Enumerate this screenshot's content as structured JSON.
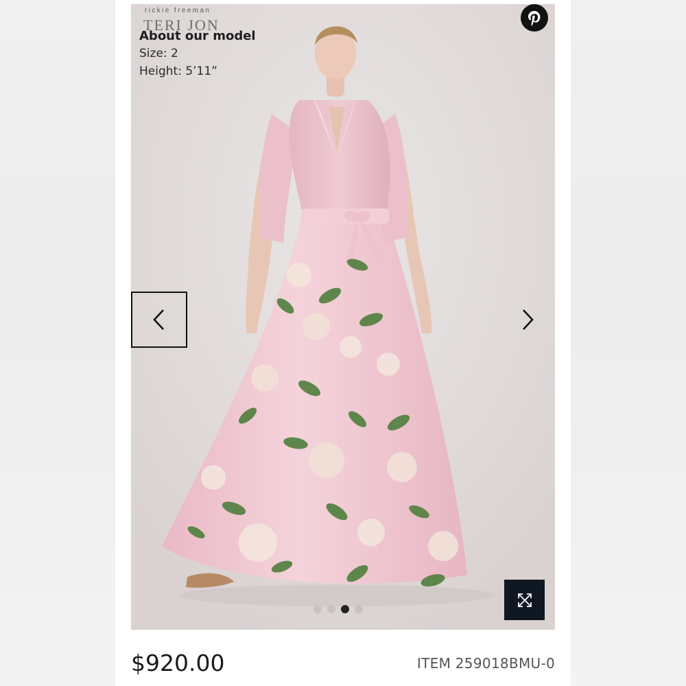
{
  "brand": {
    "designer_small": "rickie freeman",
    "designer_name": "TERI JON"
  },
  "model_info": {
    "heading": "About our model",
    "size": "Size: 2",
    "height": "Height: 5’11”"
  },
  "gallery": {
    "slide_count": 4,
    "active_slide": 3,
    "icons": {
      "share": "pinterest-icon",
      "previous": "chevron-left-icon",
      "next": "chevron-right-icon",
      "expand": "expand-icon"
    }
  },
  "product": {
    "price": "$920.00",
    "item_number": "ITEM 259018BMU-0"
  },
  "colors": {
    "dress_pink": "#f2c9d3",
    "leaf_green": "#4f7f3d",
    "rose_cream": "#f3e4dc",
    "dark_button": "#0f1822"
  }
}
